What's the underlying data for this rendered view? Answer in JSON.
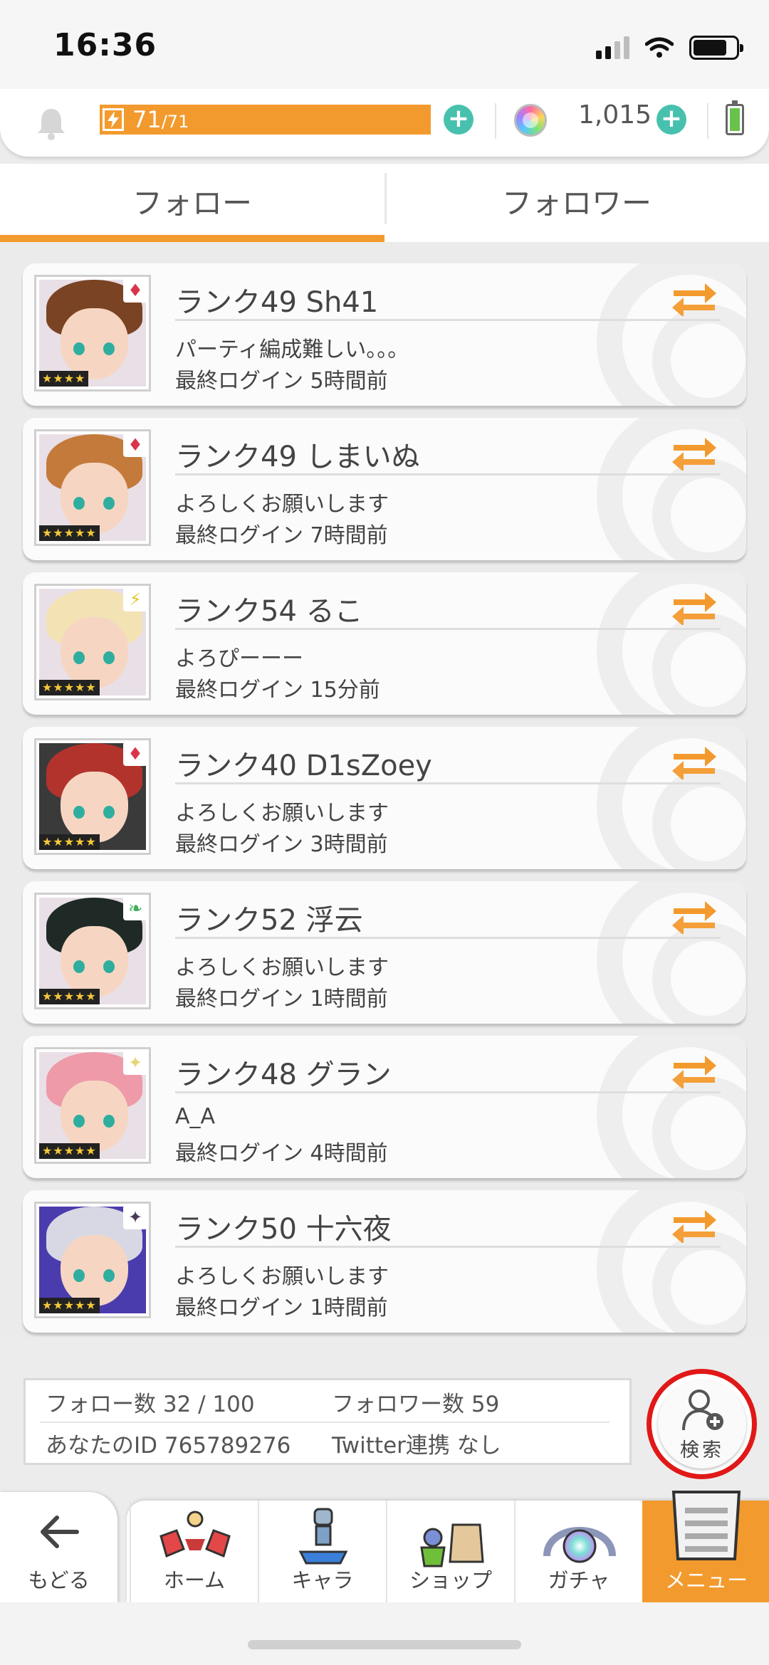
{
  "status_bar": {
    "time": "16:36"
  },
  "resources": {
    "stamina_current": "71",
    "stamina_max": "/71",
    "stamina_fraction": 1.0,
    "gem_count": "1,015",
    "accent_color": "#f39a2e",
    "plus_color": "#47c1ad"
  },
  "tabs": [
    {
      "label": "フォロー",
      "active": true
    },
    {
      "label": "フォロワー",
      "active": false
    }
  ],
  "friends": [
    {
      "title": "ランク49 Sh41",
      "message": "パーティ編成難しい。。。",
      "last_login": "最終ログイン 5時間前",
      "element": "♦",
      "element_color": "#d9354a",
      "stars": "★★★★",
      "hair": "#7a4323"
    },
    {
      "title": "ランク49 しまいぬ",
      "message": "よろしくお願いします",
      "last_login": "最終ログイン 7時間前",
      "element": "♦",
      "element_color": "#d9354a",
      "stars": "★★★★★",
      "hair": "#c47a3a"
    },
    {
      "title": "ランク54 るこ",
      "message": "よろぴーーー",
      "last_login": "最終ログイン 15分前",
      "element": "⚡",
      "element_color": "#e6c31c",
      "stars": "★★★★★",
      "hair": "#f3e3b4"
    },
    {
      "title": "ランク40 D1sZoey",
      "message": "よろしくお願いします",
      "last_login": "最終ログイン 3時間前",
      "element": "♦",
      "element_color": "#d9354a",
      "stars": "★★★★★",
      "hair": "#b2332c"
    },
    {
      "title": "ランク52 浮云",
      "message": "よろしくお願いします",
      "last_login": "最終ログイン 1時間前",
      "element": "❧",
      "element_color": "#3fae5a",
      "stars": "★★★★★",
      "hair": "#1f2a26"
    },
    {
      "title": "ランク48 グラン",
      "message": "A_A",
      "last_login": "最終ログイン 4時間前",
      "element": "✦",
      "element_color": "#e8d47a",
      "stars": "★★★★★",
      "hair": "#ee9aa8"
    },
    {
      "title": "ランク50 十六夜",
      "message": "よろしくお願いします",
      "last_login": "最終ログイン 1時間前",
      "element": "✦",
      "element_color": "#4a3a5a",
      "stars": "★★★★★",
      "hair": "#d8d8e4"
    }
  ],
  "info": {
    "follow_count": "フォロー数 32 / 100",
    "follower_count": "フォロワー数 59",
    "your_id": "あなたのID 765789276",
    "twitter": "Twitter連携 なし"
  },
  "search_button": {
    "label": "検索"
  },
  "nav": {
    "back": "もどる",
    "items": [
      {
        "label": "ホーム",
        "active": false
      },
      {
        "label": "キャラ",
        "active": false
      },
      {
        "label": "ショップ",
        "active": false
      },
      {
        "label": "ガチャ",
        "active": false
      },
      {
        "label": "メニュー",
        "active": true
      }
    ]
  }
}
